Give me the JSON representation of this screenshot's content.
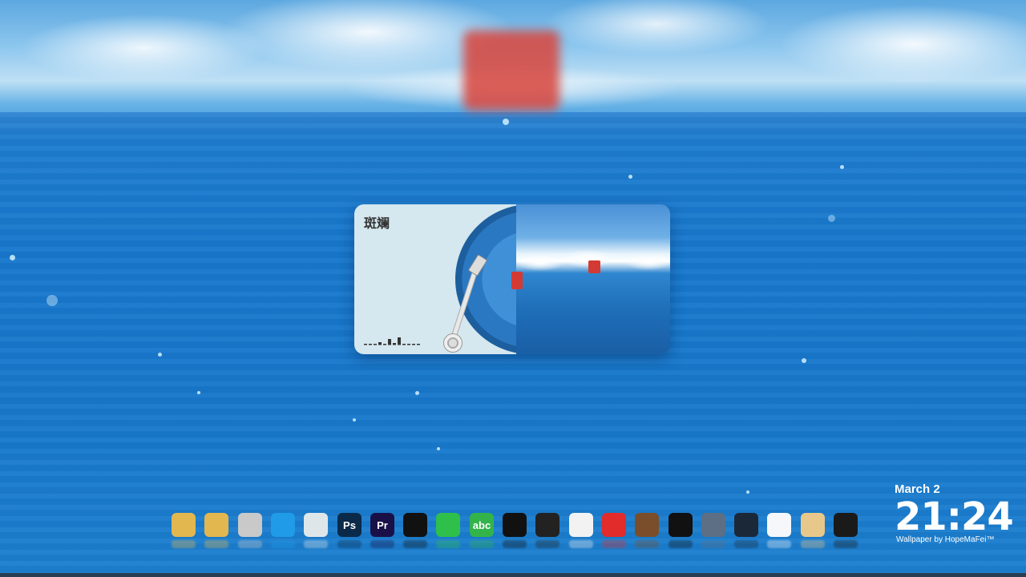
{
  "widget": {
    "song_title": "斑斓"
  },
  "dock": {
    "items": [
      {
        "name": "folder-1-icon",
        "color": "#e3b74f"
      },
      {
        "name": "folder-2-icon",
        "color": "#e3b74f"
      },
      {
        "name": "folder-3-icon",
        "color": "#c9c9c9"
      },
      {
        "name": "edge-icon",
        "color": "#1f9be8"
      },
      {
        "name": "file-manager-icon",
        "color": "#dfe6ea"
      },
      {
        "name": "photoshop-icon",
        "color": "#0b2a4a",
        "label": "Ps"
      },
      {
        "name": "premiere-icon",
        "color": "#1a1048",
        "label": "Pr"
      },
      {
        "name": "capcut-icon",
        "color": "#111111"
      },
      {
        "name": "wechat-icon",
        "color": "#2ec04b"
      },
      {
        "name": "abc-input-icon",
        "color": "#32b44a",
        "label": "abc"
      },
      {
        "name": "record-icon",
        "color": "#111111"
      },
      {
        "name": "obs-icon",
        "color": "#222222"
      },
      {
        "name": "bilibili-icon",
        "color": "#f2f2f2"
      },
      {
        "name": "netease-music-icon",
        "color": "#e22b2b"
      },
      {
        "name": "minecraft-icon",
        "color": "#7a4e2a"
      },
      {
        "name": "monitor-icon",
        "color": "#111111"
      },
      {
        "name": "gamepad-icon",
        "color": "#5d6f84"
      },
      {
        "name": "steam-icon",
        "color": "#1b2838"
      },
      {
        "name": "word-doc-icon",
        "color": "#f5f7fb"
      },
      {
        "name": "paint-icon",
        "color": "#e8c88a"
      },
      {
        "name": "window-icon",
        "color": "#1a1a1a"
      }
    ]
  },
  "clock": {
    "date": "March 2",
    "time": "21:24",
    "credit": "Wallpaper by HopeMaFei™"
  }
}
